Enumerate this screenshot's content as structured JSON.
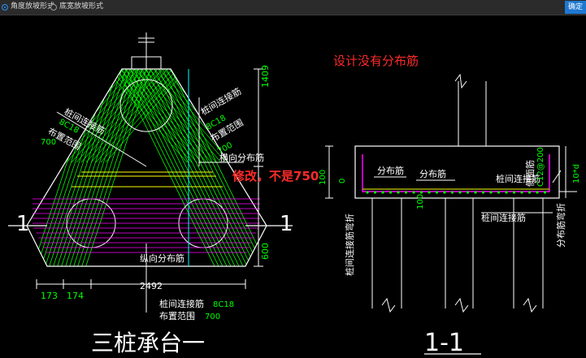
{
  "toolbar": {
    "option1": "角度放坡形式",
    "option2": "底宽放坡形式",
    "ok_label": "确定"
  },
  "drawing": {
    "left_dim_top": "1409",
    "left_dim_bottom": "600",
    "left_bottom_dims": [
      "173",
      "174",
      "2492"
    ],
    "label_pile_bar_left": "桩间连接筋",
    "label_pile_bar_left_spec": "8C18",
    "label_range_left": "布置范围",
    "label_range_left_val": "700",
    "label_pile_bar_right": "桩间连接筋",
    "label_pile_bar_right_spec": "8C18",
    "label_range_right": "布置范围",
    "label_range_right_val": "700",
    "label_horizontal_dist": "横向分布筋",
    "label_vertical_dist": "纵向分布筋",
    "label_pile_bar_bottom": "桩间连接筋",
    "label_pile_bar_bottom_spec": "8C18",
    "label_range_bottom": "布置范围",
    "label_range_bottom_val": "700",
    "section_marker": "1",
    "title_left": "三桩承台一",
    "annotation_red_top": "设计没有分布筋",
    "annotation_red_mid": "修改，不是750",
    "section_dim_left": "100",
    "section_dim_left2": "0",
    "section_dim_100b": "100",
    "label_dist_1": "分布筋",
    "label_dist_2": "分布筋",
    "label_pile_conn_1": "桩间连接筋",
    "label_pile_conn_2": "桩间连接筋",
    "label_side_bar": "侧面筋",
    "label_side_spec": "C12@200",
    "label_pile_bend": "桩间连接筋弯折",
    "label_dist_bend": "分布筋弯折",
    "label_10d": "10*d",
    "title_right": "1-1"
  },
  "colors": {
    "line_white": "#ffffff",
    "green": "#00ff00",
    "magenta": "#ff00ff",
    "yellow": "#ffff00",
    "cyan": "#00ffff",
    "red": "#ff2a2a"
  }
}
